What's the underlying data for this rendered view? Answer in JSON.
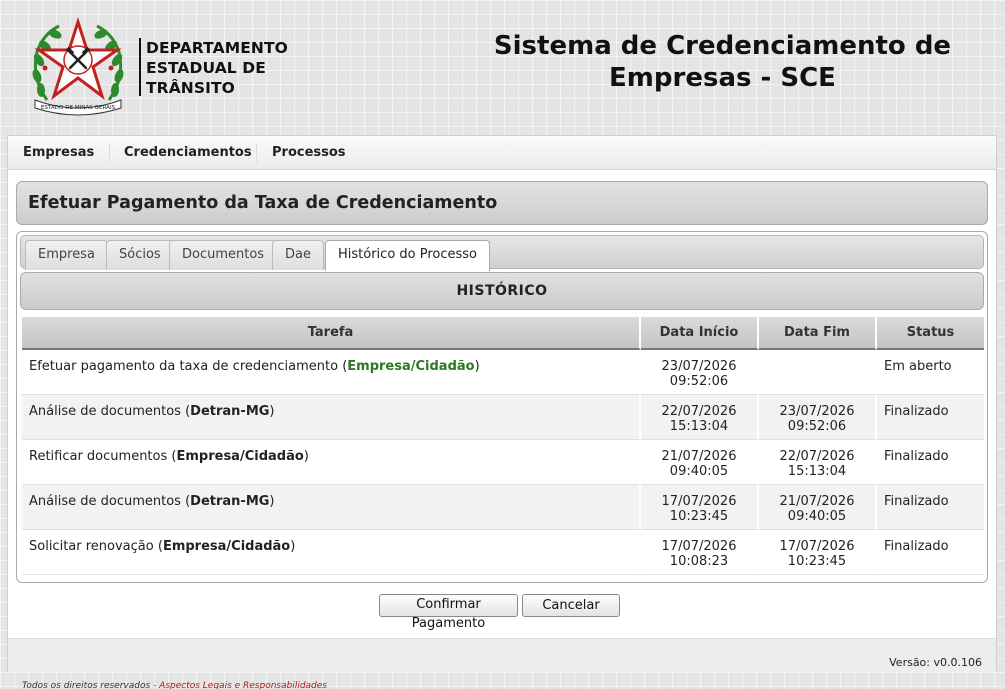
{
  "header": {
    "org_lines": [
      "DEPARTAMENTO",
      "ESTADUAL DE",
      "TRÂNSITO"
    ],
    "seal_text": "ESTADO DE MINAS GERAIS",
    "system_title_lines": [
      "Sistema de Credenciamento de",
      "Empresas - SCE"
    ]
  },
  "menu": {
    "items": [
      {
        "label": "Empresas"
      },
      {
        "label": "Credenciamentos"
      },
      {
        "label": "Processos"
      }
    ]
  },
  "page_title": "Efetuar Pagamento da Taxa de Credenciamento",
  "tabs": [
    {
      "label": "Empresa",
      "active": false
    },
    {
      "label": "Sócios",
      "active": false
    },
    {
      "label": "Documentos",
      "active": false
    },
    {
      "label": "Dae",
      "active": false
    },
    {
      "label": "Histórico do Processo",
      "active": true
    }
  ],
  "history": {
    "title": "HISTÓRICO",
    "columns": [
      "Tarefa",
      "Data Início",
      "Data Fim",
      "Status"
    ],
    "rows": [
      {
        "task": "Efetuar pagamento da taxa de credenciamento",
        "actor": "Empresa/Cidadão",
        "current": true,
        "start_date": "23/07/2026",
        "start_time": "09:52:06",
        "end_date": "",
        "end_time": "",
        "status": "Em aberto"
      },
      {
        "task": "Análise de documentos",
        "actor": "Detran-MG",
        "current": false,
        "start_date": "22/07/2026",
        "start_time": "15:13:04",
        "end_date": "23/07/2026",
        "end_time": "09:52:06",
        "status": "Finalizado"
      },
      {
        "task": "Retificar documentos",
        "actor": "Empresa/Cidadão",
        "current": false,
        "start_date": "21/07/2026",
        "start_time": "09:40:05",
        "end_date": "22/07/2026",
        "end_time": "15:13:04",
        "status": "Finalizado"
      },
      {
        "task": "Análise de documentos",
        "actor": "Detran-MG",
        "current": false,
        "start_date": "17/07/2026",
        "start_time": "10:23:45",
        "end_date": "21/07/2026",
        "end_time": "09:40:05",
        "status": "Finalizado"
      },
      {
        "task": "Solicitar renovação",
        "actor": "Empresa/Cidadão",
        "current": false,
        "start_date": "17/07/2026",
        "start_time": "10:08:23",
        "end_date": "17/07/2026",
        "end_time": "10:23:45",
        "status": "Finalizado"
      }
    ]
  },
  "buttons": {
    "confirm": "Confirmar Pagamento",
    "cancel": "Cancelar"
  },
  "footer": {
    "version": "Versão: v0.0.106",
    "copyright": "Todos os direitos reservados -",
    "legal_link": "Aspectos Legais e Responsabilidades"
  },
  "colors": {
    "current_actor": "#2a7a1f",
    "legal_link": "#b01818"
  }
}
